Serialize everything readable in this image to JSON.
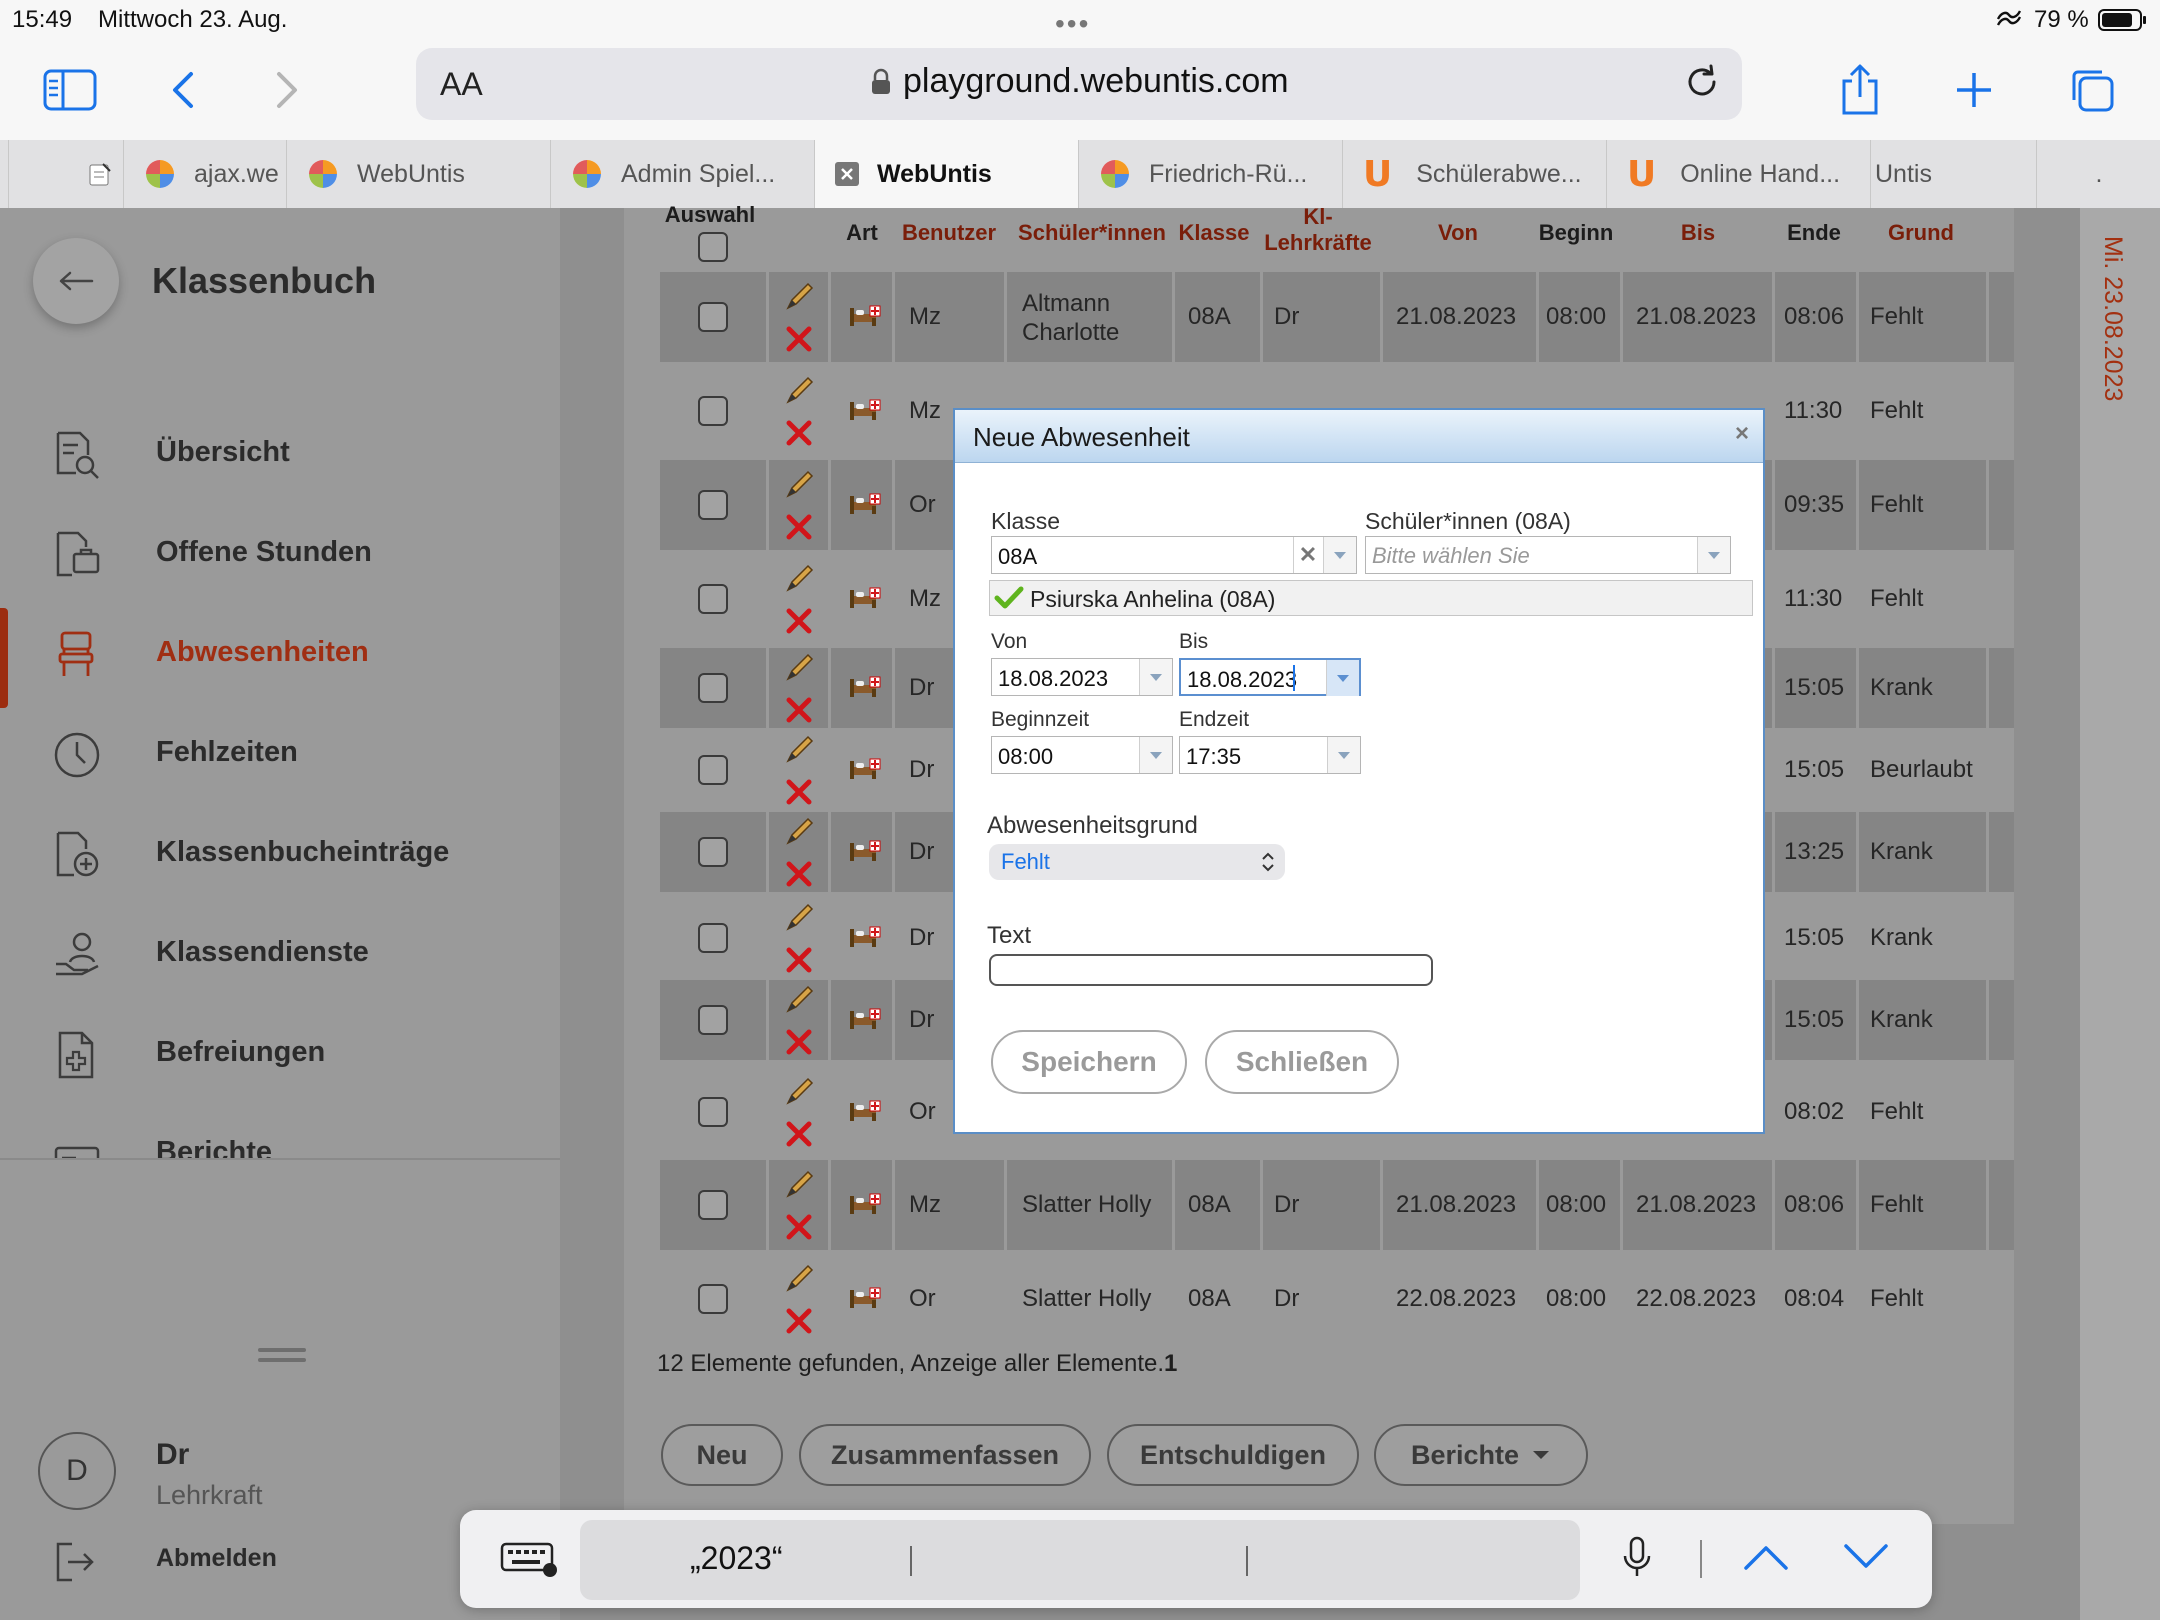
{
  "status_bar": {
    "time": "15:49",
    "date": "Mittwoch 23. Aug.",
    "dots": "•••",
    "battery": "79 %"
  },
  "browser": {
    "aa_label": "AA",
    "url": "playground.webuntis.com",
    "tabs": [
      {
        "label": "ajax.we",
        "icon": "webuntis-icon"
      },
      {
        "label": "WebUntis",
        "icon": "webuntis-icon"
      },
      {
        "label": "Admin Spiel...",
        "icon": "webuntis-icon"
      },
      {
        "label": "WebUntis",
        "icon": "close-icon",
        "active": true
      },
      {
        "label": "Friedrich-Rü...",
        "icon": "webuntis-icon"
      },
      {
        "label": "Schülerabwe...",
        "icon": "untis-u-icon"
      },
      {
        "label": "Online Hand...",
        "icon": "untis-u-icon"
      },
      {
        "label": "Untis",
        "icon": ""
      },
      {
        "label": ".",
        "icon": ""
      }
    ]
  },
  "sidebar": {
    "title": "Klassenbuch",
    "items": [
      {
        "label": "Übersicht",
        "icon": "overview-icon"
      },
      {
        "label": "Offene Stunden",
        "icon": "open-lessons-icon"
      },
      {
        "label": "Abwesenheiten",
        "icon": "chair-icon",
        "active": true
      },
      {
        "label": "Fehlzeiten",
        "icon": "clock-icon"
      },
      {
        "label": "Klassenbucheinträge",
        "icon": "add-entry-icon"
      },
      {
        "label": "Klassendienste",
        "icon": "class-service-icon"
      },
      {
        "label": "Befreiungen",
        "icon": "exemption-icon"
      },
      {
        "label": "Berichte",
        "icon": "reports-icon"
      }
    ],
    "user": {
      "initial": "D",
      "name": "Dr",
      "role": "Lehrkraft"
    },
    "logout_label": "Abmelden"
  },
  "table": {
    "headers": {
      "auswahl": "Auswahl",
      "art": "Art",
      "benutzer": "Benutzer",
      "schueler": "Schüler*innen",
      "klasse": "Klasse",
      "kl_lehrkraefte": "Kl-Lehrkräfte",
      "von": "Von",
      "beginn": "Beginn",
      "bis": "Bis",
      "ende": "Ende",
      "grund": "Grund"
    },
    "rows": [
      {
        "benutzer": "Mz",
        "schueler": "Altmann Charlotte",
        "klasse": "08A",
        "lehrkraft": "Dr",
        "von": "21.08.2023",
        "beginn": "08:00",
        "bis": "21.08.2023",
        "ende": "08:06",
        "grund": "Fehlt"
      },
      {
        "benutzer": "Mz",
        "schueler": "",
        "klasse": "",
        "lehrkraft": "",
        "von": "",
        "beginn": "",
        "bis": "",
        "ende": "11:30",
        "grund": "Fehlt"
      },
      {
        "benutzer": "Or",
        "schueler": "",
        "klasse": "",
        "lehrkraft": "",
        "von": "",
        "beginn": "",
        "bis": "",
        "ende": "09:35",
        "grund": "Fehlt"
      },
      {
        "benutzer": "Mz",
        "schueler": "",
        "klasse": "",
        "lehrkraft": "",
        "von": "",
        "beginn": "",
        "bis": "",
        "ende": "11:30",
        "grund": "Fehlt"
      },
      {
        "benutzer": "Dr",
        "schueler": "",
        "klasse": "",
        "lehrkraft": "",
        "von": "",
        "beginn": "",
        "bis": "",
        "ende": "15:05",
        "grund": "Krank"
      },
      {
        "benutzer": "Dr",
        "schueler": "",
        "klasse": "",
        "lehrkraft": "",
        "von": "",
        "beginn": "",
        "bis": "",
        "ende": "15:05",
        "grund": "Beurlaubt"
      },
      {
        "benutzer": "Dr",
        "schueler": "",
        "klasse": "",
        "lehrkraft": "",
        "von": "",
        "beginn": "",
        "bis": "",
        "ende": "13:25",
        "grund": "Krank"
      },
      {
        "benutzer": "Dr",
        "schueler": "",
        "klasse": "",
        "lehrkraft": "",
        "von": "",
        "beginn": "",
        "bis": "",
        "ende": "15:05",
        "grund": "Krank"
      },
      {
        "benutzer": "Dr",
        "schueler": "",
        "klasse": "",
        "lehrkraft": "",
        "von": "",
        "beginn": "",
        "bis": "",
        "ende": "15:05",
        "grund": "Krank"
      },
      {
        "benutzer": "Or",
        "schueler": "",
        "klasse": "",
        "lehrkraft": "",
        "von": "",
        "beginn": "",
        "bis": "",
        "ende": "08:02",
        "grund": "Fehlt"
      },
      {
        "benutzer": "Mz",
        "schueler": "Slatter Holly",
        "klasse": "08A",
        "lehrkraft": "Dr",
        "von": "21.08.2023",
        "beginn": "08:00",
        "bis": "21.08.2023",
        "ende": "08:06",
        "grund": "Fehlt"
      },
      {
        "benutzer": "Or",
        "schueler": "Slatter Holly",
        "klasse": "08A",
        "lehrkraft": "Dr",
        "von": "22.08.2023",
        "beginn": "08:00",
        "bis": "22.08.2023",
        "ende": "08:04",
        "grund": "Fehlt"
      }
    ],
    "footer": "12 Elemente gefunden, Anzeige aller Elemente.",
    "footer_page": "1",
    "buttons": {
      "neu": "Neu",
      "zusammenfassen": "Zusammenfassen",
      "entschuldigen": "Entschuldigen",
      "berichte": "Berichte"
    }
  },
  "right_rail": {
    "date": "Mi. 23.08.2023"
  },
  "dialog": {
    "title": "Neue Abwesenheit",
    "close": "×",
    "klasse_label": "Klasse",
    "klasse_value": "08A",
    "schueler_label": "Schüler*innen (08A)",
    "schueler_placeholder": "Bitte wählen Sie",
    "selected_student": "Psiurska Anhelina (08A)",
    "von_label": "Von",
    "von_value": "18.08.2023",
    "bis_label": "Bis",
    "bis_value": "18.08.2023",
    "beginnzeit_label": "Beginnzeit",
    "beginnzeit_value": "08:00",
    "endzeit_label": "Endzeit",
    "endzeit_value": "17:35",
    "grund_label": "Abwesenheitsgrund",
    "grund_value": "Fehlt",
    "text_label": "Text",
    "save_label": "Speichern",
    "close_label": "Schließen"
  },
  "keyboard": {
    "suggestion": "„2023“"
  },
  "colors": {
    "accent": "#a02e12",
    "dialog_border": "#5a8ec7",
    "link_blue": "#1a73e8"
  }
}
